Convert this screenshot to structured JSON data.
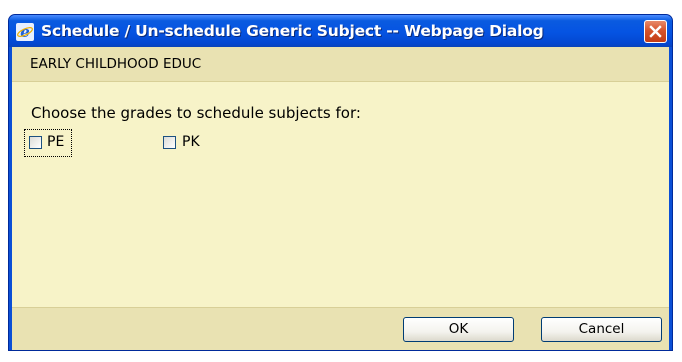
{
  "window": {
    "title": "Schedule / Un-schedule Generic Subject -- Webpage Dialog",
    "title_icon": "ie-icon",
    "close_icon": "close-icon"
  },
  "header": {
    "text": "EARLY CHILDHOOD EDUC"
  },
  "main": {
    "prompt": "Choose the grades to schedule subjects for:",
    "grades": [
      {
        "label": "PE",
        "checked": false,
        "focused": true
      },
      {
        "label": "PK",
        "checked": false,
        "focused": false
      }
    ]
  },
  "footer": {
    "ok_label": "OK",
    "cancel_label": "Cancel"
  },
  "colors": {
    "titlebar": "#0553e2",
    "client_bg": "#f7f3c8",
    "band_bg": "#e9e2b2",
    "close_button": "#d6542c"
  }
}
